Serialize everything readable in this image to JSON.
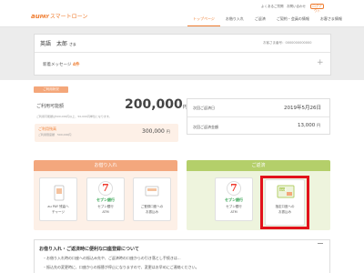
{
  "header": {
    "brand_au": "au",
    "brand_pay": "PAY",
    "brand_text": "スマートローン",
    "top_links": "よくあるご質問　お問い合わせ",
    "logout": "ログアウト",
    "nav": [
      "トップページ",
      "お借り入れ",
      "ご返済",
      "ご契約・会員の情報",
      "お客さま情報"
    ]
  },
  "user": {
    "name": "英語　太郎",
    "suffix": "さま",
    "member_no": "お客さま番号：0000000000000",
    "notice_label": "新着メッセージ",
    "notice_count": "4件"
  },
  "balance": {
    "tag": "ご利用状況",
    "limit_label": "ご利用可能額",
    "limit_amount": "200,000",
    "yen": "円",
    "limit_note": "ご利用可能額は500,000円以上、50,000円単位となります。",
    "usage_label": "ご利用残高",
    "usage_sub": "ご利用限度額　500,000円",
    "usage_amount": "300,000",
    "next_date_label": "次回ご返済日",
    "next_date": "2019年5月26日",
    "next_amount_label": "次回ご返済金額",
    "next_amount": "13,000"
  },
  "deposit": {
    "title": "お借り入れ",
    "cards": [
      {
        "icon": "payment-app-icon",
        "label_1": "au PAY 残高へ",
        "label_2": "チャージ"
      },
      {
        "icon": "seven-bank-icon",
        "brand": "セブン銀行",
        "label_1": "セブン銀行",
        "label_2": "ATM"
      },
      {
        "icon": "bank-transfer-icon",
        "label_1": "ご登録口座への",
        "label_2": "お振込み"
      }
    ]
  },
  "repay": {
    "title": "ご返済",
    "cards": [
      {
        "icon": "seven-bank-icon",
        "brand": "セブン銀行",
        "label_1": "セブン銀行",
        "label_2": "ATM"
      },
      {
        "icon": "bank-account-icon",
        "label_1": "指定口座への",
        "label_2": "お振込み"
      }
    ]
  },
  "info": {
    "title": "お借り入れ・ご返済時に便利な口座登録について",
    "line_1": "・お借り入れ時の口座への振込み先や、ご返済時の口座からの引き落とし手続きは...",
    "line_2": "・振込先の変更時に、口座からの振替が停止になりますので、変更はお早めにご連絡ください。"
  },
  "colors": {
    "accent": "#ef7c2f",
    "deposit": "#f3a77d",
    "repay": "#b4cf6a",
    "highlight": "#e2121b"
  }
}
